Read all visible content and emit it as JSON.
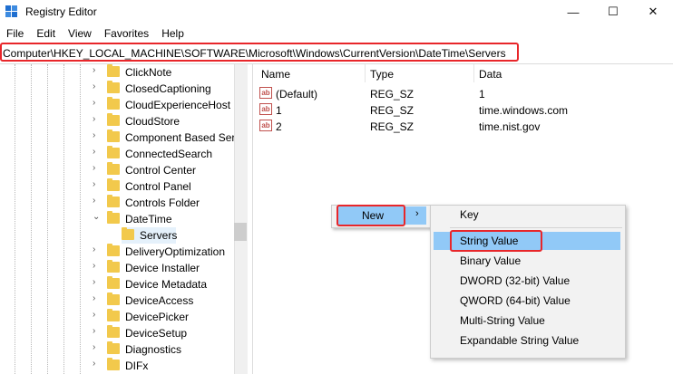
{
  "window": {
    "title": "Registry Editor",
    "controls": {
      "minimize": "—",
      "maximize": "☐",
      "close": "✕"
    }
  },
  "menubar": [
    "File",
    "Edit",
    "View",
    "Favorites",
    "Help"
  ],
  "address": "Computer\\HKEY_LOCAL_MACHINE\\SOFTWARE\\Microsoft\\Windows\\CurrentVersion\\DateTime\\Servers",
  "tree": {
    "items": [
      {
        "label": "ClickNote",
        "level": 1,
        "expanded": false
      },
      {
        "label": "ClosedCaptioning",
        "level": 1,
        "expanded": false
      },
      {
        "label": "CloudExperienceHost",
        "level": 1,
        "expanded": false
      },
      {
        "label": "CloudStore",
        "level": 1,
        "expanded": false
      },
      {
        "label": "Component Based Serv",
        "level": 1,
        "expanded": false
      },
      {
        "label": "ConnectedSearch",
        "level": 1,
        "expanded": false
      },
      {
        "label": "Control Center",
        "level": 1,
        "expanded": false
      },
      {
        "label": "Control Panel",
        "level": 1,
        "expanded": false
      },
      {
        "label": "Controls Folder",
        "level": 1,
        "expanded": false
      },
      {
        "label": "DateTime",
        "level": 1,
        "expanded": true
      },
      {
        "label": "Servers",
        "level": 2,
        "selected": true
      },
      {
        "label": "DeliveryOptimization",
        "level": 1,
        "expanded": false
      },
      {
        "label": "Device Installer",
        "level": 1,
        "expanded": false
      },
      {
        "label": "Device Metadata",
        "level": 1,
        "expanded": false
      },
      {
        "label": "DeviceAccess",
        "level": 1,
        "expanded": false
      },
      {
        "label": "DevicePicker",
        "level": 1,
        "expanded": false
      },
      {
        "label": "DeviceSetup",
        "level": 1,
        "expanded": false
      },
      {
        "label": "Diagnostics",
        "level": 1,
        "expanded": false
      },
      {
        "label": "DIFx",
        "level": 1,
        "expanded": false
      }
    ]
  },
  "values": {
    "columns": [
      "Name",
      "Type",
      "Data"
    ],
    "rows": [
      {
        "icon": "ab",
        "name": "(Default)",
        "type": "REG_SZ",
        "data": "1"
      },
      {
        "icon": "ab",
        "name": "1",
        "type": "REG_SZ",
        "data": "time.windows.com"
      },
      {
        "icon": "ab",
        "name": "2",
        "type": "REG_SZ",
        "data": "time.nist.gov"
      }
    ]
  },
  "context_menu": {
    "new_label": "New",
    "arrow": "›",
    "submenu": [
      "Key",
      "String Value",
      "Binary Value",
      "DWORD (32-bit) Value",
      "QWORD (64-bit) Value",
      "Multi-String Value",
      "Expandable String Value"
    ]
  },
  "colors": {
    "highlight_red": "#e8262a",
    "hover_blue": "#91c9f7",
    "folder_yellow": "#f2c94c"
  }
}
